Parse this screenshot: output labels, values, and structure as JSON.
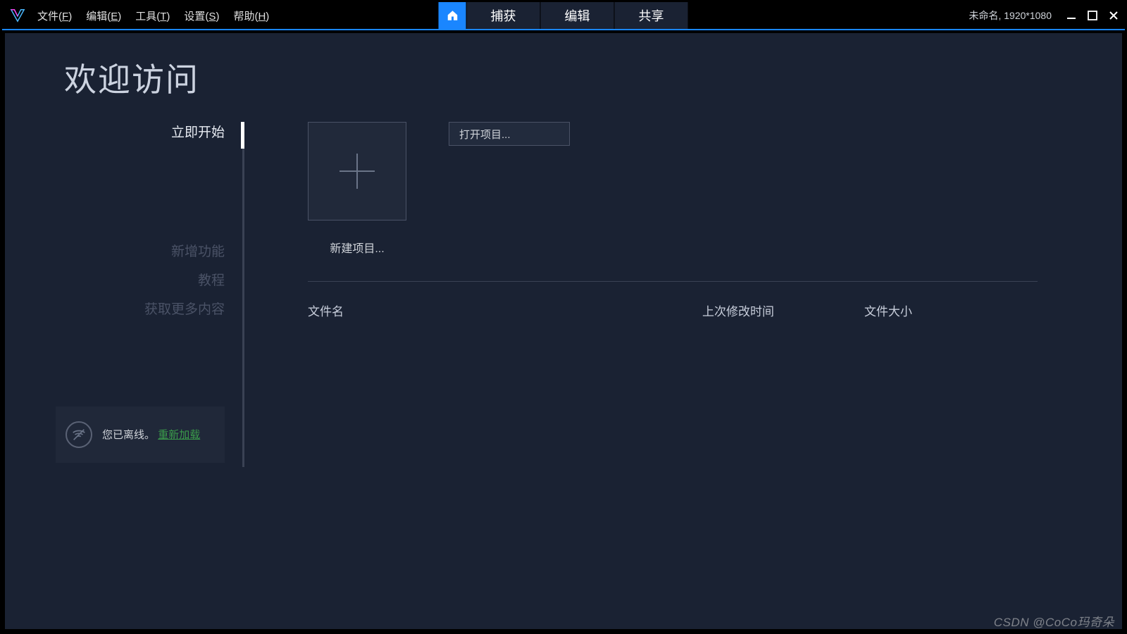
{
  "menubar": {
    "items": [
      {
        "label": "文件",
        "accel": "F"
      },
      {
        "label": "编辑",
        "accel": "E"
      },
      {
        "label": "工具",
        "accel": "T"
      },
      {
        "label": "设置",
        "accel": "S"
      },
      {
        "label": "帮助",
        "accel": "H"
      }
    ]
  },
  "modeTabs": {
    "capture": "捕获",
    "edit": "编辑",
    "share": "共享"
  },
  "titleStatus": "未命名, 1920*1080",
  "page": {
    "title": "欢迎访问"
  },
  "sidebar": {
    "start": "立即开始",
    "whatsnew": "新增功能",
    "tutorials": "教程",
    "getmore": "获取更多内容"
  },
  "offline": {
    "text": "您已离线。",
    "reload": "重新加载"
  },
  "actions": {
    "newProject": "新建项目...",
    "openProject": "打开项目..."
  },
  "table": {
    "filename": "文件名",
    "modified": "上次修改时间",
    "size": "文件大小"
  },
  "watermark": "CSDN @CoCo玛奇朵"
}
